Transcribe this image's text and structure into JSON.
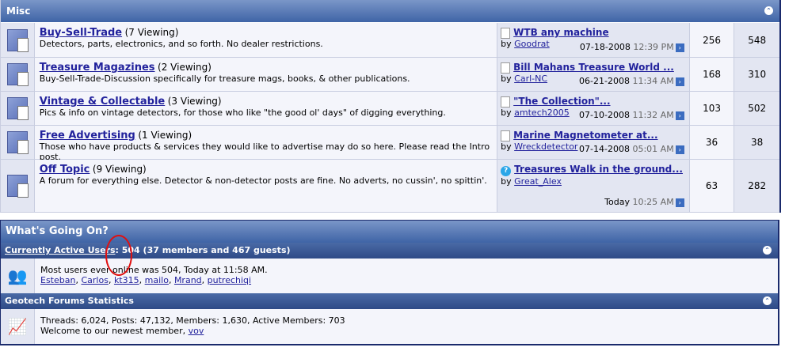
{
  "misc": {
    "title": "Misc",
    "forums": [
      {
        "title": "Buy-Sell-Trade",
        "viewing": "(7 Viewing)",
        "desc": "Detectors, parts, electronics, and so forth. No dealer restrictions.",
        "last_title": "WTB any machine",
        "by": "by",
        "author": "Goodrat",
        "date": "07-18-2008",
        "time": "12:39 PM",
        "threads": "256",
        "posts": "548",
        "icon": "page"
      },
      {
        "title": "Treasure Magazines",
        "viewing": "(2 Viewing)",
        "desc": "Buy-Sell-Trade-Discussion specifically for treasure mags, books, & other publications.",
        "last_title": "Bill Mahans Treasure World ...",
        "by": "by",
        "author": "Carl-NC",
        "date": "06-21-2008",
        "time": "11:34 AM",
        "threads": "168",
        "posts": "310",
        "icon": "page"
      },
      {
        "title": "Vintage & Collectable",
        "viewing": "(3 Viewing)",
        "desc": "Pics & info on vintage detectors, for those who like \"the good ol' days\" of digging everything.",
        "last_title": "\"The Collection\"...",
        "by": "by",
        "author": "amtech2005",
        "date": "07-10-2008",
        "time": "11:32 AM",
        "threads": "103",
        "posts": "502",
        "icon": "page"
      },
      {
        "title": "Free Advertising",
        "viewing": "(1 Viewing)",
        "desc": "Those who have products & services they would like to advertise may do so here. Please read the Intro post.",
        "last_title": "Marine Magnetometer at...",
        "by": "by",
        "author": "Wreckdetector",
        "date": "07-14-2008",
        "time": "05:01 AM",
        "threads": "36",
        "posts": "38",
        "icon": "page"
      },
      {
        "title": "Off Topic",
        "viewing": "(9 Viewing)",
        "desc": "A forum for everything else. Detector & non-detector posts are fine. No adverts, no cussin', no spittin'.",
        "last_title": "Treasures Walk in the ground...",
        "by": "by",
        "author": "Great_Alex",
        "date": "Today",
        "time": "10:25 AM",
        "threads": "63",
        "posts": "282",
        "icon": "question"
      }
    ]
  },
  "wgo": {
    "title": "What's Going On?",
    "active_link": "Currently Active Users",
    "active_rest": ": 504 (37 members and 467 guests)",
    "most_users": "Most users ever online was 504, Today at 11:58 AM.",
    "users": [
      "Esteban",
      "Carlos",
      "kt315",
      "mailo",
      "Mrand",
      "putrechiqi"
    ],
    "stats_title": "Geotech Forums Statistics",
    "stats": "Threads: 6,024, Posts: 47,132, Members: 1,630, Active Members: 703",
    "welcome": "Welcome to our newest member, ",
    "newest": "vov"
  }
}
